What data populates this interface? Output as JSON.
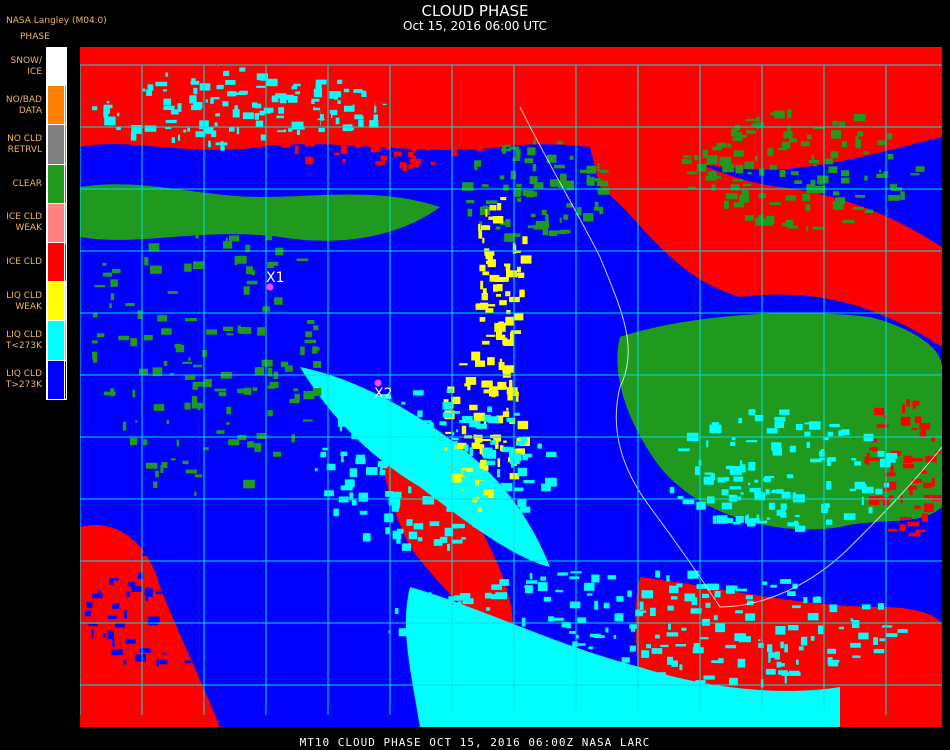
{
  "header": {
    "title": "CLOUD PHASE",
    "subtitle": "Oct 15, 2016 06:00 UTC",
    "source": "NASA Langley (M04.0)",
    "legend_title": "PHASE"
  },
  "legend": [
    {
      "label": "SNOW/\nICE",
      "color": "#ffffff"
    },
    {
      "label": "NO/BAD\nDATA",
      "color": "#ff8000"
    },
    {
      "label": "NO CLD\nRETRVL",
      "color": "#808080"
    },
    {
      "label": "CLEAR",
      "color": "#1f9a1f"
    },
    {
      "label": "ICE CLD\nWEAK",
      "color": "#ff8080"
    },
    {
      "label": "ICE CLD",
      "color": "#ff0000"
    },
    {
      "label": "LIQ CLD\nWEAK",
      "color": "#ffff00"
    },
    {
      "label": "LIQ CLD\nT<273K",
      "color": "#00ffff"
    },
    {
      "label": "LIQ CLD\nT>273K",
      "color": "#0000ff"
    }
  ],
  "markers": [
    {
      "label": "X1"
    },
    {
      "label": "X2"
    }
  ],
  "footer": "MT10  CLOUD PHASE   OCT 15, 2016 06:00Z   NASA LARC",
  "colors": {
    "grid": "#00e0e0",
    "marker": "#ff40ff",
    "ocean_liq": "#0000ff",
    "ice": "#ff0000",
    "clear": "#1f9a1f",
    "liq_cold": "#00ffff",
    "liq_weak": "#ffff00"
  }
}
